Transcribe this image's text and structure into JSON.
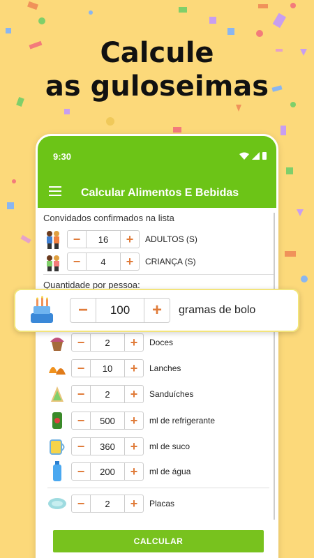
{
  "headline": [
    "Calcule",
    "as guloseimas"
  ],
  "status": {
    "time": "9:30"
  },
  "appbar": {
    "title": "Calcular Alimentos E Bebidas"
  },
  "guests": {
    "label": "Convidados confirmados na lista",
    "rows": [
      {
        "value": "16",
        "label": "ADULTOS (S)",
        "icon": "adults-icon"
      },
      {
        "value": "4",
        "label": "CRIANÇA (S)",
        "icon": "children-icon"
      }
    ]
  },
  "per_person": {
    "label": "Quantidade por pessoa:"
  },
  "popup": {
    "value": "100",
    "label": "gramas de bolo",
    "icon": "cake-icon"
  },
  "items": [
    {
      "value": "2",
      "label": "Doces",
      "icon": "cupcake-icon"
    },
    {
      "value": "10",
      "label": "Lanches",
      "icon": "snack-icon"
    },
    {
      "value": "2",
      "label": "Sanduíches",
      "icon": "sandwich-icon"
    },
    {
      "value": "500",
      "label": "ml de refrigerante",
      "icon": "soda-can-icon"
    },
    {
      "value": "360",
      "label": "ml de suco",
      "icon": "juice-jug-icon"
    },
    {
      "value": "200",
      "label": "ml de água",
      "icon": "water-bottle-icon"
    }
  ],
  "plates": {
    "value": "2",
    "label": "Placas",
    "icon": "plate-icon"
  },
  "stepper": {
    "minus": "−",
    "plus": "+"
  },
  "calculate_label": "CALCULAR",
  "colors": {
    "primary": "#6cc417",
    "accent": "#e07b39",
    "background": "#fcd97a"
  }
}
